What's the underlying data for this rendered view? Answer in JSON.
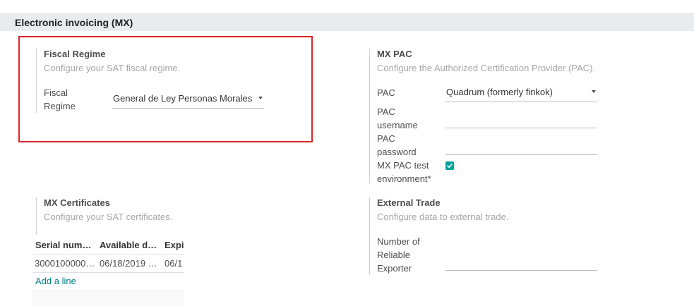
{
  "section": {
    "title": "Electronic invoicing (MX)"
  },
  "fiscal_regime": {
    "title": "Fiscal Regime",
    "description": "Configure your SAT fiscal regime.",
    "field_label_line1": "Fiscal",
    "field_label_line2": "Regime",
    "value": "General de Ley Personas Morales"
  },
  "mx_pac": {
    "title": "MX PAC",
    "description": "Configure the Authorized Certification Provider (PAC).",
    "pac_label": "PAC",
    "pac_value": "Quadrum (formerly finkok)",
    "username_label_line1": "PAC",
    "username_label_line2": "username",
    "password_label_line1": "PAC",
    "password_label_line2": "password",
    "test_env_label_line1": "MX PAC test",
    "test_env_label_line2": "environment*",
    "test_env_checked": true
  },
  "mx_certificates": {
    "title": "MX Certificates",
    "description": "Configure your SAT certificates.",
    "columns": [
      "Serial num…",
      "Available d…",
      "Expi"
    ],
    "rows": [
      [
        "3000100000…",
        "06/18/2019 …",
        "06/1"
      ]
    ],
    "add_line": "Add a line"
  },
  "external_trade": {
    "title": "External Trade",
    "description": "Configure data to external trade.",
    "exporter_label_line1": "Number of",
    "exporter_label_line2": "Reliable",
    "exporter_label_line3": "Exporter"
  },
  "colors": {
    "accent": "#00a09d",
    "link": "#017e84",
    "highlight": "#d9262a"
  }
}
